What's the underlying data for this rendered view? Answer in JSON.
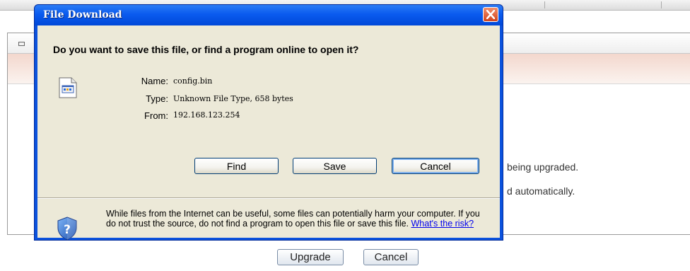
{
  "background": {
    "line1": "being upgraded.",
    "line2": "d automatically.",
    "upgrade_label": "Upgrade",
    "cancel_label": "Cancel"
  },
  "dialog": {
    "title": "File Download",
    "question": "Do you want to save this file, or find a program online to open it?",
    "fields": {
      "name_label": "Name:",
      "name_value": "config.bin",
      "type_label": "Type:",
      "type_value": "Unknown File Type, 658 bytes",
      "from_label": "From:",
      "from_value": "192.168.123.254"
    },
    "buttons": {
      "find": "Find",
      "save": "Save",
      "cancel": "Cancel"
    },
    "warning": "While files from the Internet can be useful, some files can potentially harm your computer. If you do not trust the source, do not find a program to open this file or save this file.",
    "risk_link": "What's the risk?",
    "icons": {
      "close": "close-icon",
      "file": "unknown-file-icon",
      "shield": "security-shield-icon"
    },
    "colors": {
      "titlebar": "#0a5bef",
      "close": "#d1431c",
      "body": "#ece9d8",
      "link": "#0000ee"
    }
  }
}
